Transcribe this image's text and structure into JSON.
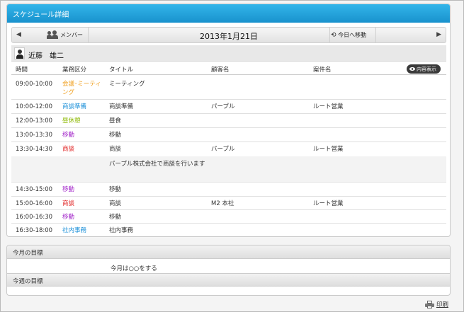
{
  "panel": {
    "title": "スケジュール詳細"
  },
  "nav": {
    "prev": "◀",
    "next": "▶",
    "member_label": "メンバー",
    "date": "2013年1月21日",
    "today_label": "今日へ移動"
  },
  "user": {
    "name": "近藤　雄二"
  },
  "table": {
    "headers": {
      "time": "時間",
      "category": "業務区分",
      "title": "タイトル",
      "customer": "顧客名",
      "project": "案件名"
    },
    "content_button": "内容表示",
    "rows": [
      {
        "time": "09:00-10:00",
        "category": "会議･ミーティング",
        "category_color": "#f0a020",
        "title": "ミーティング",
        "customer": "",
        "project": ""
      },
      {
        "time": "10:00-12:00",
        "category": "商談準備",
        "category_color": "#1a8fd8",
        "title": "商談準備",
        "customer": "パープル",
        "project": "ルート営業"
      },
      {
        "time": "12:00-13:00",
        "category": "昼休憩",
        "category_color": "#8cb800",
        "title": "昼食",
        "customer": "",
        "project": ""
      },
      {
        "time": "13:00-13:30",
        "category": "移動",
        "category_color": "#a020c8",
        "title": "移動",
        "customer": "",
        "project": ""
      },
      {
        "time": "13:30-14:30",
        "category": "商談",
        "category_color": "#e02020",
        "title": "商談",
        "customer": "パープル",
        "project": "ルート営業",
        "detail": "パープル株式会社で商談を行います"
      },
      {
        "time": "14:30-15:00",
        "category": "移動",
        "category_color": "#a020c8",
        "title": "移動",
        "customer": "",
        "project": ""
      },
      {
        "time": "15:00-16:00",
        "category": "商談",
        "category_color": "#e02020",
        "title": "商談",
        "customer": "M2 本社",
        "project": "ルート営業"
      },
      {
        "time": "16:00-16:30",
        "category": "移動",
        "category_color": "#a020c8",
        "title": "移動",
        "customer": "",
        "project": ""
      },
      {
        "time": "16:30-18:00",
        "category": "社内事務",
        "category_color": "#1a8fd8",
        "title": "社内事務",
        "customer": "",
        "project": ""
      }
    ]
  },
  "goals": {
    "month_label": "今月の目標",
    "month_text": "今月は○○をする",
    "week_label": "今週の目標",
    "week_text": ""
  },
  "print_label": "印刷"
}
